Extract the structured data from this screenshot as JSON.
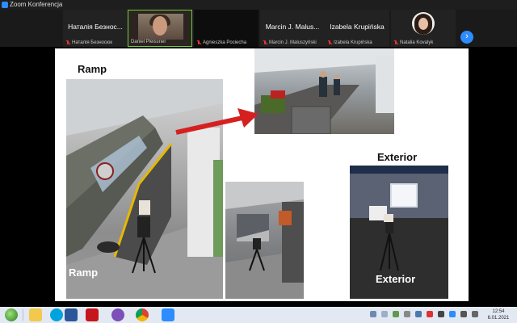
{
  "window": {
    "title": "Zoom Konferencja"
  },
  "participants": [
    {
      "display_name": "Наталія Безнос...",
      "label": "Наталія Безносюк",
      "muted": true,
      "video": false
    },
    {
      "display_name": "",
      "label": "Daniel Pleissner",
      "muted": false,
      "video": true,
      "active": true
    },
    {
      "display_name": "",
      "label": "Agnieszka Pociecha",
      "muted": true,
      "video": false
    },
    {
      "display_name": "Marcin J. Malus...",
      "label": "Marcin J. Maluszyński",
      "muted": true,
      "video": false
    },
    {
      "display_name": "Izabela Krupińska",
      "label": "Izabela Krupińska",
      "muted": true,
      "video": false
    },
    {
      "display_name": "",
      "label": "Natalia Kovalyk",
      "muted": true,
      "video": false,
      "avatar": "photo"
    }
  ],
  "strip_next_icon": "chevron-right-icon",
  "slide": {
    "title_ramp_top": "Ramp",
    "title_ramp_bottom": "Ramp",
    "title_exterior_top": "Exterior",
    "title_exterior_bottom": "Exterior",
    "arrow_color": "#d62020"
  },
  "taskbar": {
    "apps": [
      "windows-start-icon",
      "explorer-icon",
      "skype-icon",
      "word-icon",
      "acrobat-icon",
      "viber-icon",
      "chrome-icon",
      "zoom-icon"
    ],
    "tray_time": "12:54",
    "tray_date": "6.01.2021"
  }
}
